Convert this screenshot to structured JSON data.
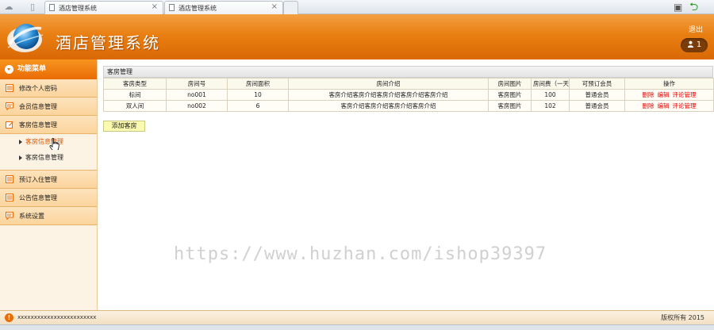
{
  "browser": {
    "tabs": [
      {
        "title": "酒店管理系统"
      },
      {
        "title": "酒店管理系统"
      }
    ],
    "close_glyph": "×"
  },
  "header": {
    "title": "酒店管理系统",
    "logout": "退出",
    "user_count": "1"
  },
  "sidebar": {
    "heading": "功能菜单",
    "items": [
      {
        "label": "修改个人密码",
        "icon": "list-icon"
      },
      {
        "label": "会员信息管理",
        "icon": "chat-icon"
      },
      {
        "label": "客房信息管理",
        "icon": "edit-icon"
      },
      {
        "label": "预订入住管理",
        "icon": "list-icon"
      },
      {
        "label": "公告信息管理",
        "icon": "list-icon"
      },
      {
        "label": "系统设置",
        "icon": "chat-icon"
      }
    ],
    "subitems": [
      {
        "label": "客房信息管理",
        "active": true
      },
      {
        "label": "客房信息管理",
        "active": false
      }
    ]
  },
  "main": {
    "panel_title": "客房管理",
    "columns": [
      "客房类型",
      "房间号",
      "房间面积",
      "房间介绍",
      "房间图片",
      "房间费（一天）",
      "可预订会员",
      "操作"
    ],
    "rows": [
      {
        "type": "标间",
        "room_no": "no001",
        "area": "10",
        "intro": "客房介绍客房介绍客房介绍客房介绍客房介绍",
        "image": "客房图片",
        "price": "100",
        "member": "普通会员"
      },
      {
        "type": "双人间",
        "room_no": "no002",
        "area": "6",
        "intro": "客房介绍客房介绍客房介绍客房介绍",
        "image": "客房图片",
        "price": "102",
        "member": "普通会员"
      }
    ],
    "actions": {
      "delete": "删除",
      "edit": "编辑",
      "comments": "评论管理"
    },
    "add_button": "添加客房",
    "watermark": "https://www.huzhan.com/ishop39397"
  },
  "footer": {
    "left_text": "xxxxxxxxxxxxxxxxxxxxxxxx",
    "copyright": "版权所有 2015"
  },
  "colors": {
    "header_orange": "#e97f12",
    "sidebar_bg": "#fdf3e4",
    "action_red": "#e60000"
  }
}
